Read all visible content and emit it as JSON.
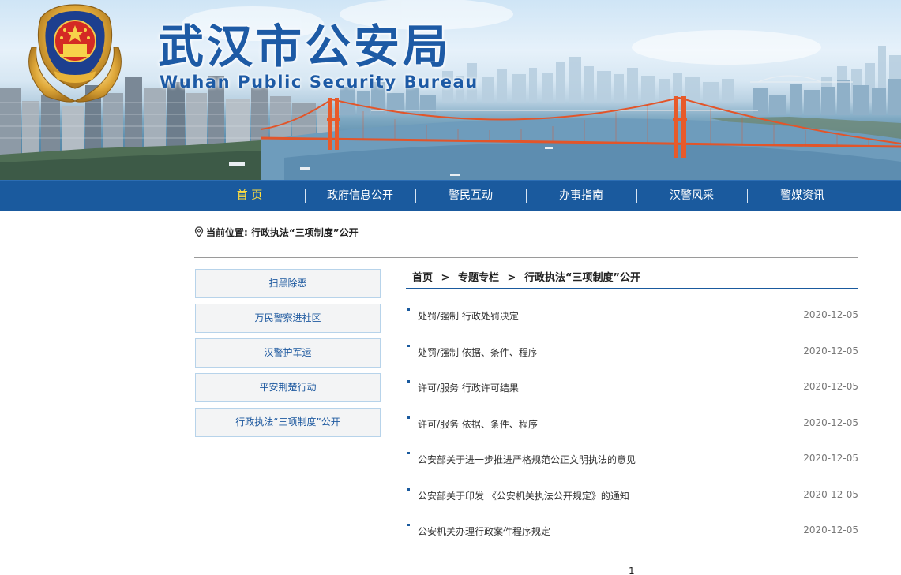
{
  "header": {
    "title_cn": "武汉市公安局",
    "title_en": "Wuhan Public Security Bureau",
    "emblem_icon": "police-emblem-icon"
  },
  "nav": {
    "items": [
      {
        "label": "首 页",
        "active": true
      },
      {
        "label": "政府信息公开",
        "active": false
      },
      {
        "label": "警民互动",
        "active": false
      },
      {
        "label": "办事指南",
        "active": false
      },
      {
        "label": "汉警风采",
        "active": false
      },
      {
        "label": "警媒资讯",
        "active": false
      }
    ]
  },
  "location": {
    "prefix": "当前位置:",
    "current": "行政执法“三项制度”公开",
    "icon": "location-pin-icon"
  },
  "sidebar": {
    "items": [
      {
        "label": "扫黑除恶"
      },
      {
        "label": "万民警察进社区"
      },
      {
        "label": "汉警护军运"
      },
      {
        "label": "平安荆楚行动"
      },
      {
        "label": "行政执法“三项制度”公开"
      }
    ]
  },
  "breadcrumb": {
    "home": "首页",
    "section": "专题专栏",
    "current": "行政执法“三项制度”公开",
    "separator": ">"
  },
  "list": {
    "items": [
      {
        "title": "处罚/强制 行政处罚决定",
        "date": "2020-12-05"
      },
      {
        "title": "处罚/强制 依据、条件、程序",
        "date": "2020-12-05"
      },
      {
        "title": "许可/服务 行政许可结果",
        "date": "2020-12-05"
      },
      {
        "title": "许可/服务 依据、条件、程序",
        "date": "2020-12-05"
      },
      {
        "title": "公安部关于进一步推进严格规范公正文明执法的意见",
        "date": "2020-12-05"
      },
      {
        "title": "公安部关于印发 《公安机关执法公开规定》的通知",
        "date": "2020-12-05"
      },
      {
        "title": "公安机关办理行政案件程序规定",
        "date": "2020-12-05"
      }
    ]
  },
  "pager": {
    "current_page": "1"
  },
  "colors": {
    "brand_blue": "#1a5a9e",
    "nav_active": "#ffde3f",
    "sidebar_text": "#1f5aa0",
    "bridge_red": "#e2552a"
  }
}
